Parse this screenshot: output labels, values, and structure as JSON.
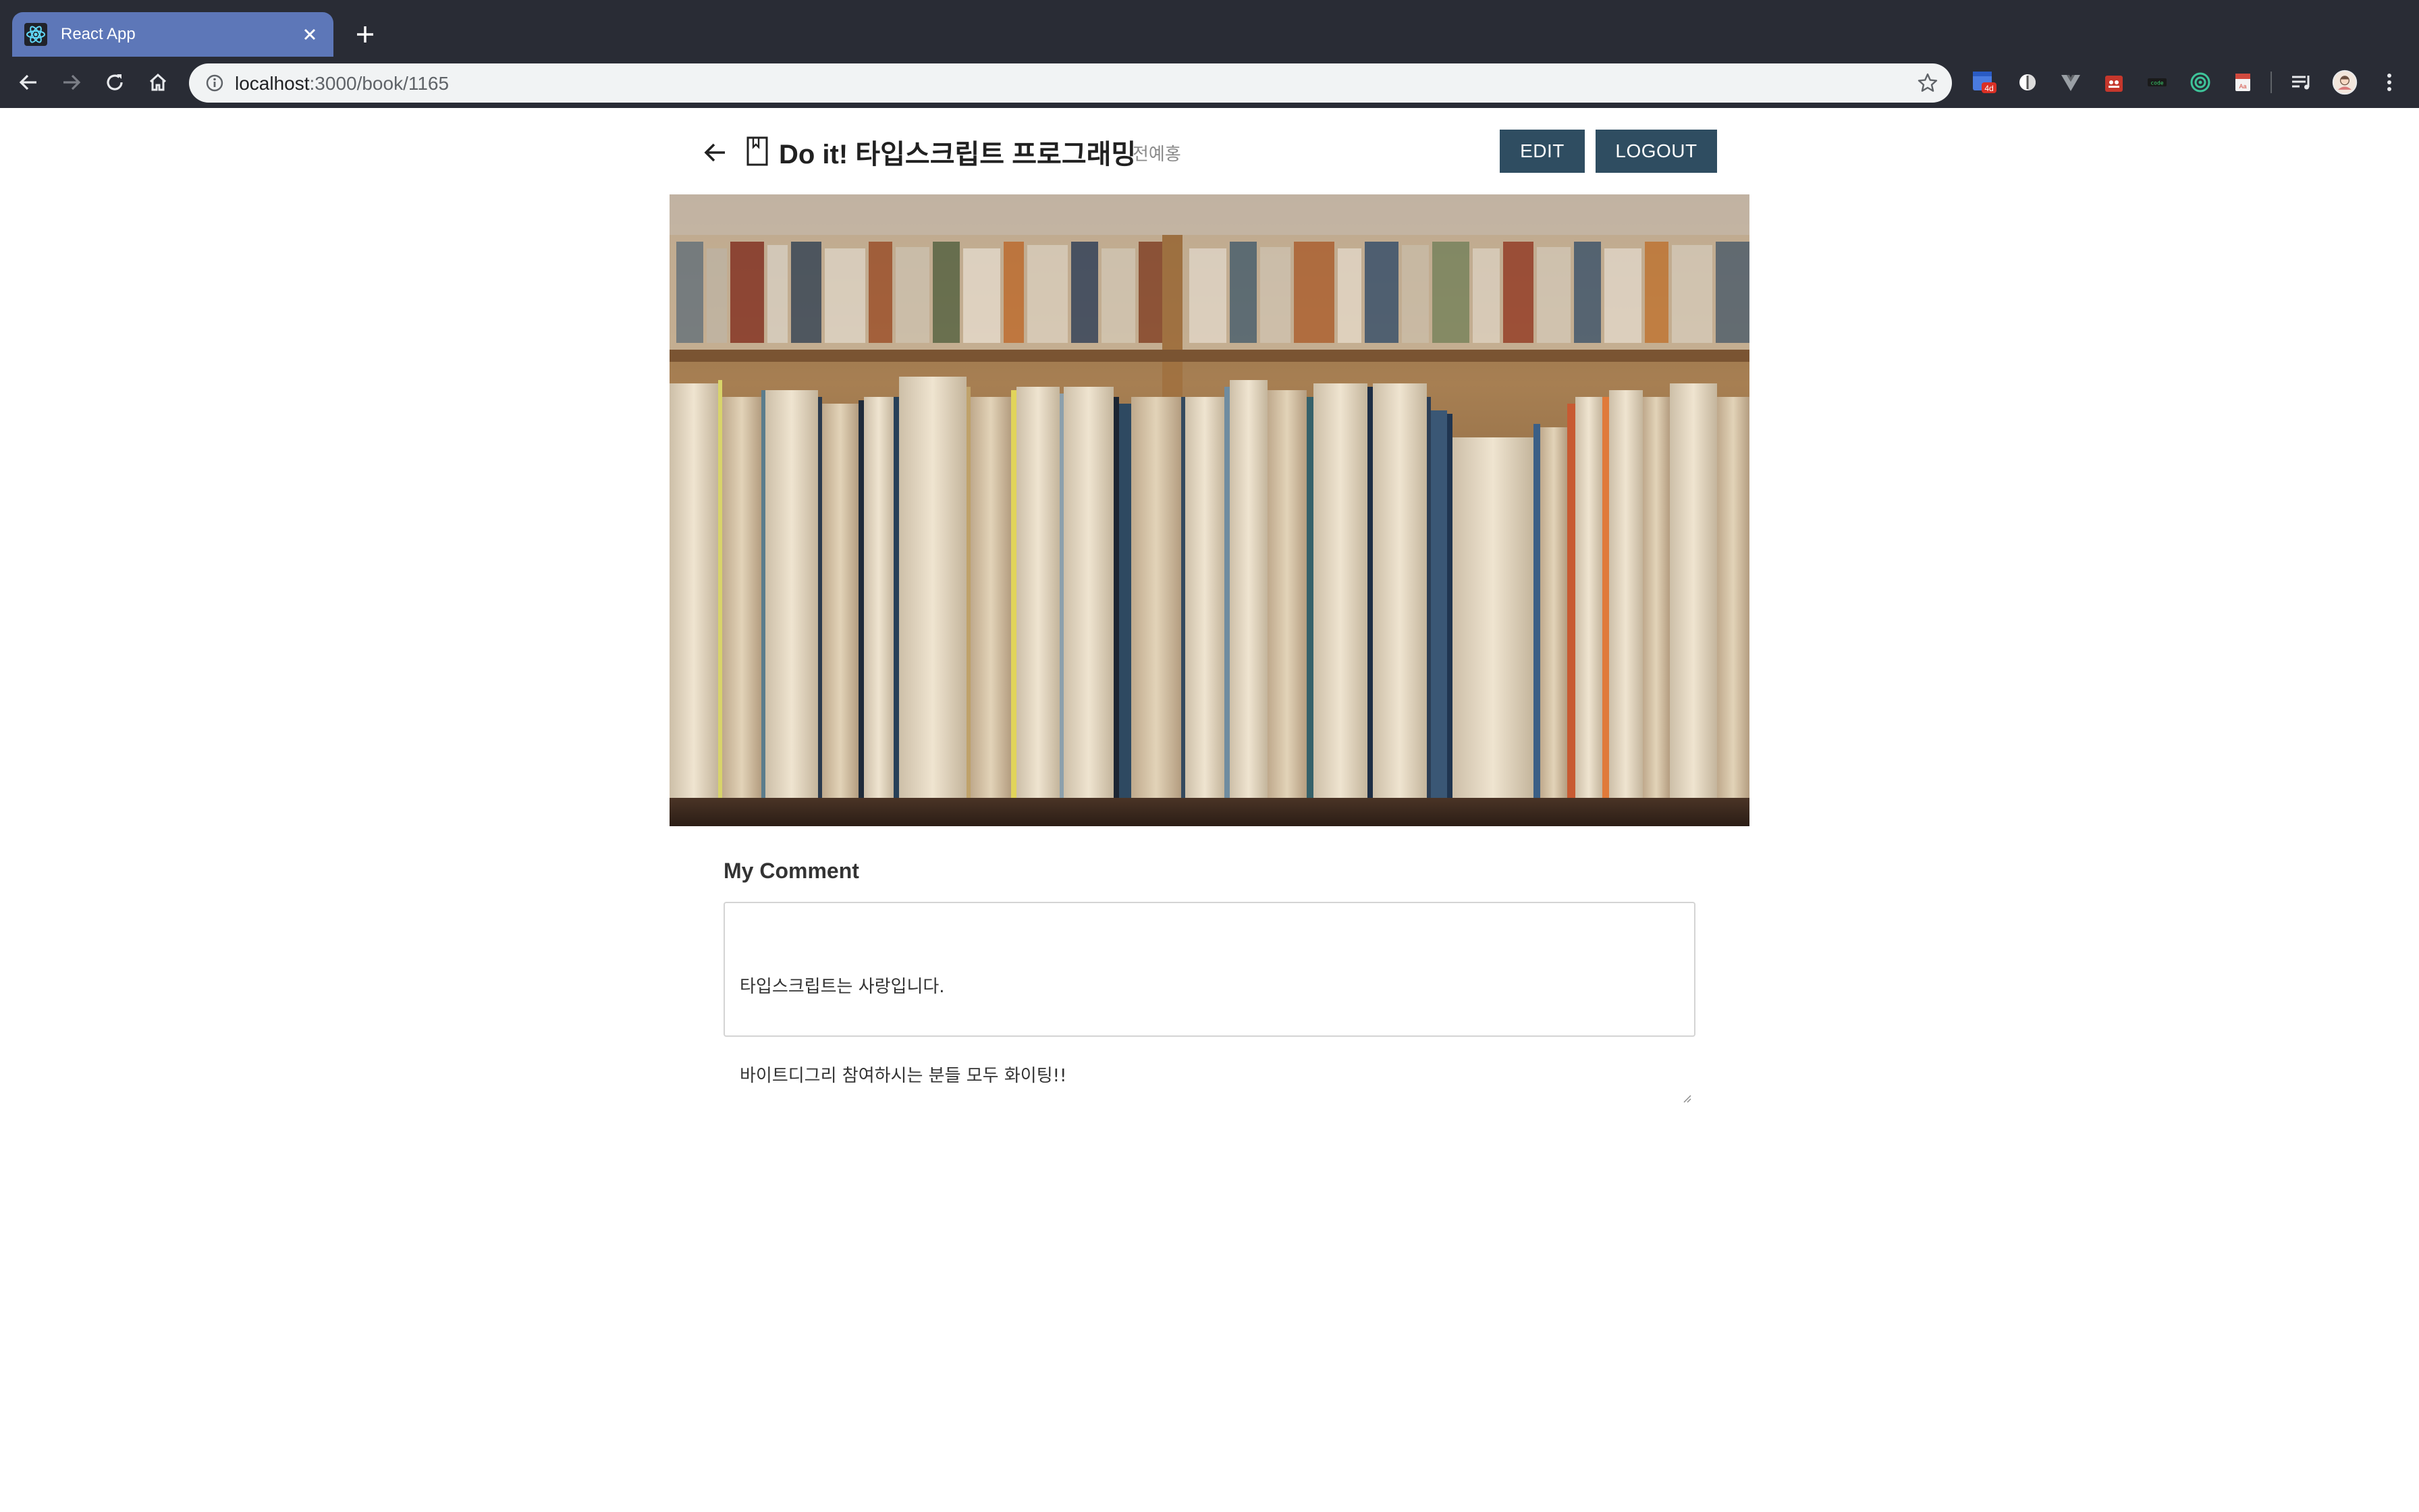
{
  "browser": {
    "tab": {
      "title": "React App"
    },
    "omnibox": {
      "host": "localhost",
      "path": ":3000/book/1165"
    },
    "extensions": [
      "calendar-icon",
      "circle-icon",
      "vue-icon",
      "gift-icon",
      "code-icon",
      "target-icon",
      "pdf-icon",
      "playlist-icon",
      "avatar-icon",
      "menu-icon"
    ],
    "badge": "4d"
  },
  "page": {
    "title": "Do it! 타입스크립트 프로그래밍",
    "author": "전예홍",
    "buttons": {
      "edit": "EDIT",
      "logout": "LOGOUT"
    },
    "comment": {
      "label": "My Comment",
      "lines": [
        "타입스크립트는 사랑입니다.",
        "바이트디그리 참여하시는 분들 모두 화이팅!!"
      ]
    }
  },
  "colors": {
    "chrome_bg": "#292c35",
    "active_tab": "#5d77b8",
    "button_bg": "#2f4d61"
  }
}
